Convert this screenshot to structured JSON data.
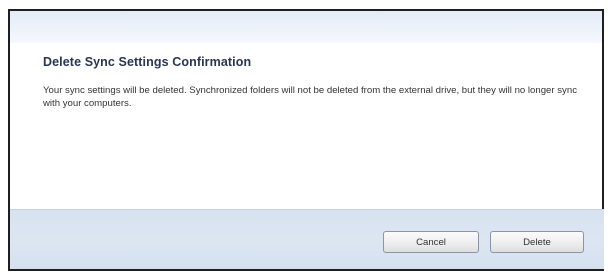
{
  "dialog": {
    "title": "Delete Sync Settings Confirmation",
    "message": "Your sync settings will be deleted. Synchronized folders will not be deleted from the external drive, but they will no longer sync with your computers."
  },
  "buttons": {
    "cancel_label": "Cancel",
    "delete_label": "Delete"
  }
}
